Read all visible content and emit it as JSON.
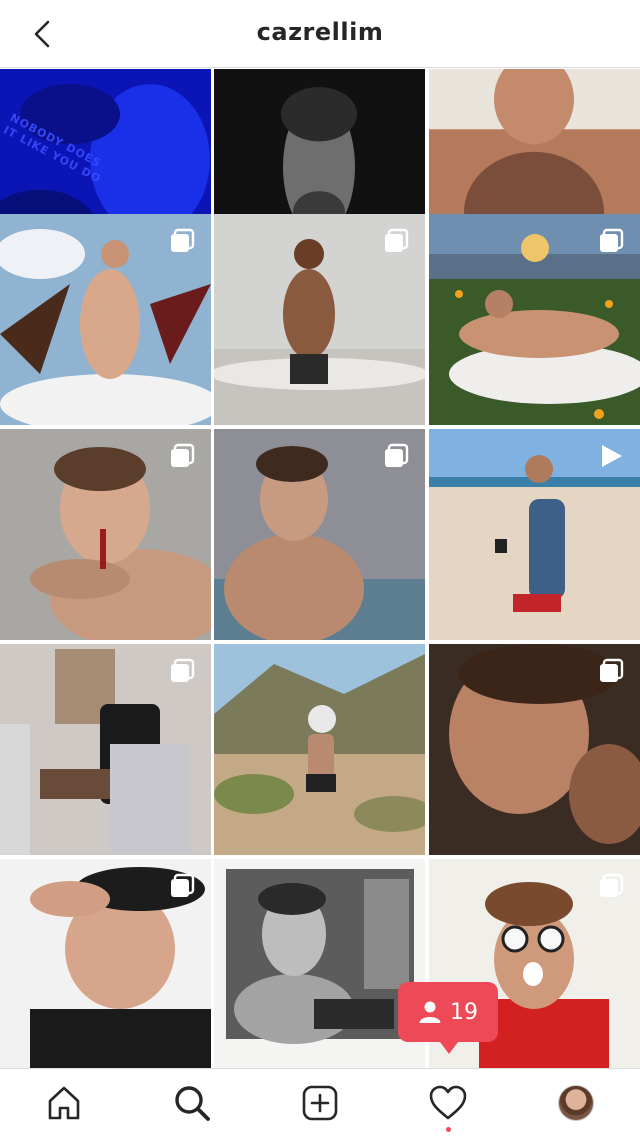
{
  "header": {
    "username": "cazrellim"
  },
  "grid": {
    "tiles": [
      {
        "kind": "single",
        "scene": "blue",
        "caption": "NOBODY DOES IT LIKE YOU DO"
      },
      {
        "kind": "single",
        "scene": "bw"
      },
      {
        "kind": "single",
        "scene": "warm"
      },
      {
        "kind": "carousel",
        "scene": "sky"
      },
      {
        "kind": "carousel",
        "scene": "sea"
      },
      {
        "kind": "carousel",
        "scene": "field"
      },
      {
        "kind": "carousel",
        "scene": "portrait"
      },
      {
        "kind": "carousel",
        "scene": "dim"
      },
      {
        "kind": "video",
        "scene": "beach"
      },
      {
        "kind": "carousel",
        "scene": "room"
      },
      {
        "kind": "single",
        "scene": "canyon"
      },
      {
        "kind": "carousel",
        "scene": "close"
      },
      {
        "kind": "carousel",
        "scene": "cap"
      },
      {
        "kind": "single",
        "scene": "polaroid"
      },
      {
        "kind": "carousel",
        "scene": "glasses"
      }
    ]
  },
  "toast": {
    "count": "19",
    "icon": "person-icon",
    "color": "#ed4956"
  },
  "tabbar": {
    "items": [
      "home-icon",
      "search-icon",
      "add-post-icon",
      "heart-icon",
      "profile-avatar"
    ],
    "active": "search-icon",
    "notification_color": "#ed4956"
  }
}
